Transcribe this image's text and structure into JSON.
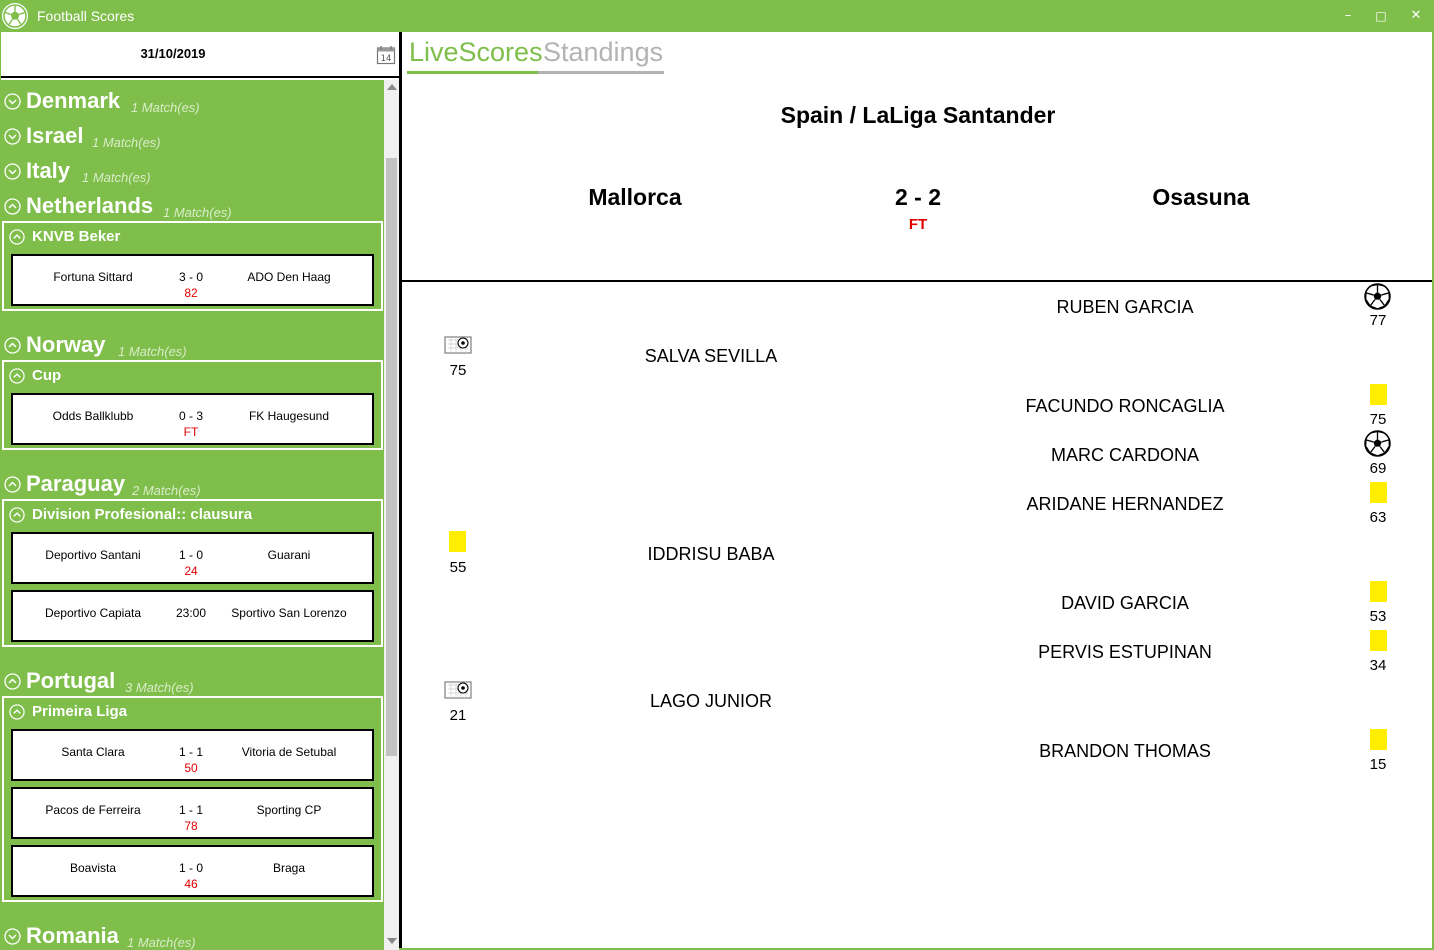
{
  "window": {
    "title": "Football Scores",
    "controls": {
      "minimize": "–",
      "maximize": "□",
      "close": "✕"
    },
    "accent_color": "#7fbe4b"
  },
  "sidebar": {
    "date": "31/10/2019",
    "calendar_icon_day": "14",
    "countries": [
      {
        "name": "Denmark",
        "count": "1 Match(es)",
        "expanded": false
      },
      {
        "name": "Israel",
        "count": "1 Match(es)",
        "expanded": false
      },
      {
        "name": "Italy",
        "count": "1 Match(es)",
        "expanded": false
      },
      {
        "name": "Netherlands",
        "count": "1 Match(es)",
        "expanded": true,
        "league": "KNVB Beker",
        "matches": [
          {
            "home": "Fortuna Sittard",
            "score": "3 - 0",
            "away": "ADO Den Haag",
            "status": "82"
          }
        ]
      },
      {
        "name": "Norway",
        "count": "1 Match(es)",
        "expanded": true,
        "league": "Cup",
        "matches": [
          {
            "home": "Odds Ballklubb",
            "score": "0 - 3",
            "away": "FK Haugesund",
            "status": "FT"
          }
        ]
      },
      {
        "name": "Paraguay",
        "count": "2 Match(es)",
        "expanded": true,
        "league": "Division Profesional:: clausura",
        "matches": [
          {
            "home": "Deportivo Santani",
            "score": "1 - 0",
            "away": "Guarani",
            "status": "24"
          },
          {
            "home": "Deportivo Capiata",
            "score": "23:00",
            "away": "Sportivo San Lorenzo",
            "status": ""
          }
        ]
      },
      {
        "name": "Portugal",
        "count": "3 Match(es)",
        "expanded": true,
        "league": "Primeira Liga",
        "matches": [
          {
            "home": "Santa Clara",
            "score": "1 - 1",
            "away": "Vitoria de Setubal",
            "status": "50"
          },
          {
            "home": "Pacos de Ferreira",
            "score": "1 - 1",
            "away": "Sporting CP",
            "status": "78"
          },
          {
            "home": "Boavista",
            "score": "1 - 0",
            "away": "Braga",
            "status": "46"
          }
        ]
      },
      {
        "name": "Romania",
        "count": "1 Match(es)",
        "expanded": false
      }
    ]
  },
  "tabs": {
    "live": "LiveScores",
    "standings": "Standings",
    "active": "live"
  },
  "match": {
    "league_title": "Spain / LaLiga Santander",
    "home_team": "Mallorca",
    "away_team": "Osasuna",
    "score": "2 - 2",
    "status": "FT",
    "events": [
      {
        "side": "away",
        "player": "RUBEN GARCIA",
        "type": "goal",
        "minute": "77"
      },
      {
        "side": "home",
        "player": "SALVA SEVILLA",
        "type": "penalty-goal",
        "minute": "75"
      },
      {
        "side": "away",
        "player": "FACUNDO RONCAGLIA",
        "type": "yellow-card",
        "minute": "75"
      },
      {
        "side": "away",
        "player": "MARC CARDONA",
        "type": "goal",
        "minute": "69"
      },
      {
        "side": "away",
        "player": "ARIDANE HERNANDEZ",
        "type": "yellow-card",
        "minute": "63"
      },
      {
        "side": "home",
        "player": "IDDRISU BABA",
        "type": "yellow-card",
        "minute": "55"
      },
      {
        "side": "away",
        "player": "DAVID GARCIA",
        "type": "yellow-card",
        "minute": "53"
      },
      {
        "side": "away",
        "player": "PERVIS ESTUPINAN",
        "type": "yellow-card",
        "minute": "34"
      },
      {
        "side": "home",
        "player": "LAGO JUNIOR",
        "type": "penalty-goal",
        "minute": "21"
      },
      {
        "side": "away",
        "player": "BRANDON THOMAS",
        "type": "yellow-card",
        "minute": "15"
      }
    ]
  }
}
